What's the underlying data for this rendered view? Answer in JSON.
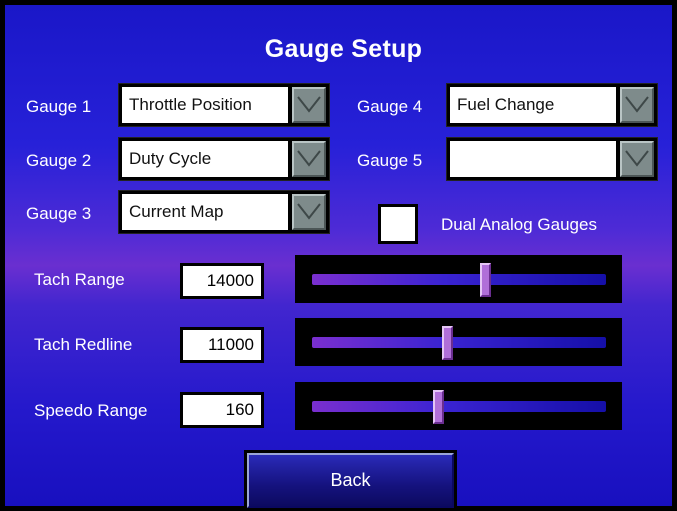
{
  "title": "Gauge Setup",
  "gauges": [
    {
      "label": "Gauge 1",
      "value": "Throttle Position"
    },
    {
      "label": "Gauge 2",
      "value": "Duty Cycle"
    },
    {
      "label": "Gauge 3",
      "value": "Current Map"
    },
    {
      "label": "Gauge 4",
      "value": "Fuel Change"
    },
    {
      "label": "Gauge 5",
      "value": ""
    }
  ],
  "dual_analog": {
    "label": "Dual Analog Gauges",
    "checked": false
  },
  "settings": [
    {
      "label": "Tach Range",
      "value": "14000",
      "slider_level": 0.59
    },
    {
      "label": "Tach Redline",
      "value": "11000",
      "slider_level": 0.46
    },
    {
      "label": "Speedo Range",
      "value": "160",
      "slider_level": 0.43
    }
  ],
  "back_label": "Back",
  "colors": {
    "background": "#2721d8",
    "accent": "#6a2fd0",
    "slider_thumb": "#b06fd8"
  },
  "icons": {
    "dropdown": "chevron-down-icon"
  }
}
